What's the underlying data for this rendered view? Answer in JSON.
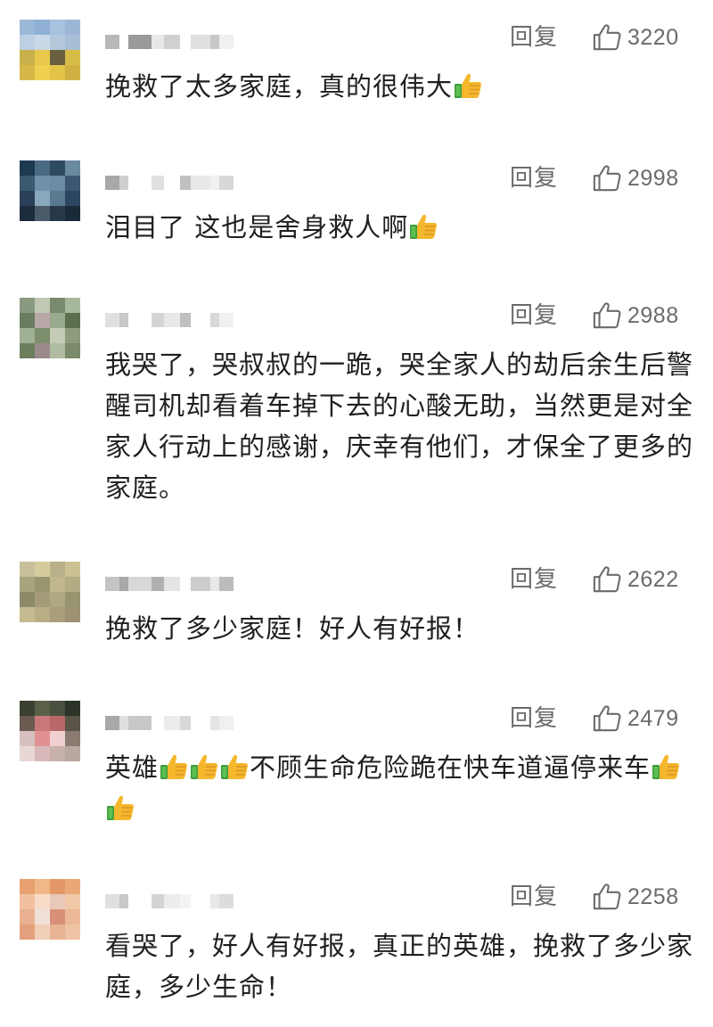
{
  "comments": [
    {
      "avatar_colors": [
        "#9ab8d8",
        "#8fb0d4",
        "#a6c2de",
        "#9cb6d6",
        "#bcd0e4",
        "#c8d8e6",
        "#b4c8dc",
        "#a8bed6",
        "#c9b04a",
        "#e8c84a",
        "#6a6040",
        "#d8bc48",
        "#d6b848",
        "#f0d050",
        "#e4c448",
        "#cfb044"
      ],
      "username_blocks": [
        "#b8b8b8",
        "#ffffff",
        "#9a9a9a",
        "#e8e8e8",
        "#d0d0d0",
        "#ffffff",
        "#e0e0e0",
        "#c8c8c8",
        "#f0f0f0"
      ],
      "reply_label": "回复",
      "likes": "3220",
      "text": "挽救了太多家庭，真的很伟大",
      "emoji_after": 1
    },
    {
      "avatar_colors": [
        "#1e3a50",
        "#4a6a84",
        "#2e4a60",
        "#6a8aa0",
        "#3a5a70",
        "#6f90a8",
        "#6a8ca4",
        "#3c5870",
        "#2a4058",
        "#8aa8bc",
        "#5a7a90",
        "#2c4660",
        "#1c2c3c",
        "#4a5a68",
        "#28384a",
        "#1a2a38"
      ],
      "username_blocks": [
        "#a8a8a8",
        "#d0d0d0",
        "#ffffff",
        "#e0e0e0",
        "#ffffff",
        "#c0c0c0",
        "#e8e8e8",
        "#f0f0f0",
        "#d8d8d8"
      ],
      "reply_label": "回复",
      "likes": "2998",
      "text": "泪目了 这也是舍身救人啊",
      "emoji_after": 1
    },
    {
      "avatar_colors": [
        "#8a9a80",
        "#c0c8b4",
        "#7a8a6c",
        "#a8b89c",
        "#6a7c60",
        "#b8a8a8",
        "#9aaa8c",
        "#5c7050",
        "#a0b094",
        "#7c8e6c",
        "#c4ccb8",
        "#8c9c7c",
        "#6c7e5c",
        "#9a8a8a",
        "#b0bca0",
        "#7a8a6a"
      ],
      "username_blocks": [
        "#e0e0e0",
        "#c8c8c8",
        "#ffffff",
        "#d4d4d4",
        "#e8e8e8",
        "#c0c0c0",
        "#ffffff",
        "#d8d8d8",
        "#f0f0f0"
      ],
      "reply_label": "回复",
      "likes": "2988",
      "text": "我哭了，哭叔叔的一跪，哭全家人的劫后余生后警醒司机却看着车掉下去的心酸无助，当然更是对全家人行动上的感谢，庆幸有他们，才保全了更多的家庭。",
      "emoji_after": 0
    },
    {
      "avatar_colors": [
        "#c8c09a",
        "#d4cc9c",
        "#b8b088",
        "#cac294",
        "#a8a47c",
        "#9a9670",
        "#c0b88c",
        "#b4ac84",
        "#8c8a68",
        "#a49c78",
        "#b0a882",
        "#989470",
        "#c4bc90",
        "#b8ae86",
        "#a89e7a",
        "#9c9272"
      ],
      "username_blocks": [
        "#c4c4c4",
        "#a8a8a8",
        "#d8d8d8",
        "#b0b0b0",
        "#e4e4e4",
        "#ffffff",
        "#cccccc",
        "#e8e8e8",
        "#bcbcbc"
      ],
      "reply_label": "回复",
      "likes": "2622",
      "text": "挽救了多少家庭！好人有好报！",
      "emoji_after": 0
    },
    {
      "avatar_colors": [
        "#3a4030",
        "#5a6048",
        "#4a5040",
        "#2c3428",
        "#6a5a50",
        "#c87878",
        "#b86868",
        "#5a5448",
        "#d8c0c0",
        "#e09090",
        "#f0d0d0",
        "#8a7a70",
        "#e8d8d4",
        "#d8b8b8",
        "#c8b0ac",
        "#b8a8a0"
      ],
      "username_blocks": [
        "#a8a8a8",
        "#e0e0e0",
        "#c8c8c8",
        "#ffffff",
        "#ececec",
        "#d8d8d8",
        "#ffffff",
        "#e4e4e4",
        "#f0f0f0"
      ],
      "reply_label": "回复",
      "likes": "2479",
      "text": "英雄{E}{E}{E}不顾生命危险跪在快车道逼停来车{E}{E}",
      "emoji_after": 0
    },
    {
      "avatar_colors": [
        "#e8a070",
        "#f0b888",
        "#e49868",
        "#eaa878",
        "#f2c0a0",
        "#f8dcc8",
        "#e8c8b8",
        "#f0c8a8",
        "#e8b090",
        "#f0e0d8",
        "#d89078",
        "#ecb898",
        "#e4a07c",
        "#f0d0b8",
        "#e8b494",
        "#eec4a4"
      ],
      "username_blocks": [
        "#e0e0e0",
        "#c8c8c8",
        "#ffffff",
        "#d4d4d4",
        "#ececec",
        "#f4f4f4",
        "#ffffff",
        "#e8e8e8",
        "#dcdcdc"
      ],
      "reply_label": "回复",
      "likes": "2258",
      "text": "看哭了，好人有好报，真正的英雄，挽救了多少家庭，多少生命！",
      "emoji_after": 0
    }
  ]
}
